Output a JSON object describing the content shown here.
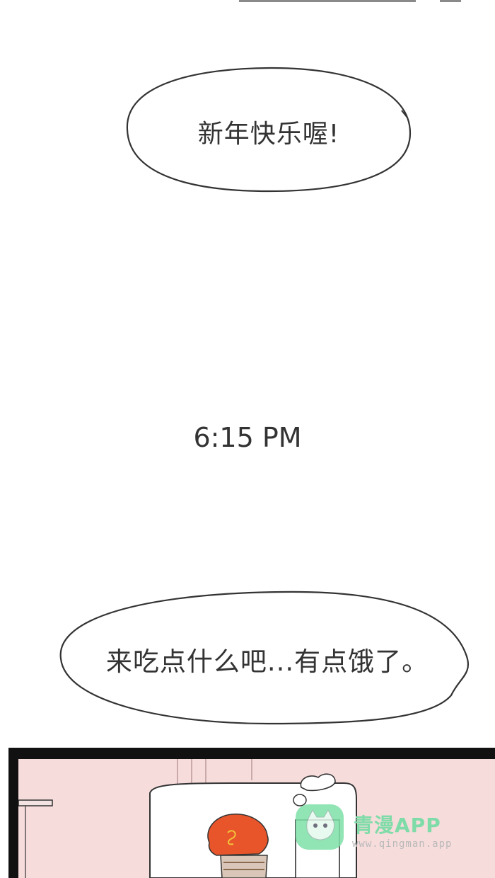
{
  "bubbles": [
    {
      "text": "新年快乐喔!"
    },
    {
      "text": "来吃点什么吧...有点饿了。"
    }
  ],
  "time_caption": "6:15 PM",
  "watermark": {
    "title": "青漫APP",
    "url": "www.qingman.app"
  },
  "colors": {
    "text": "#333333",
    "panel_bg": "#f7dcdc",
    "panel_border": "#111111",
    "hair": "#e8552a",
    "watermark": "#7fdca8"
  },
  "icons": [
    "cat-logo-icon"
  ]
}
